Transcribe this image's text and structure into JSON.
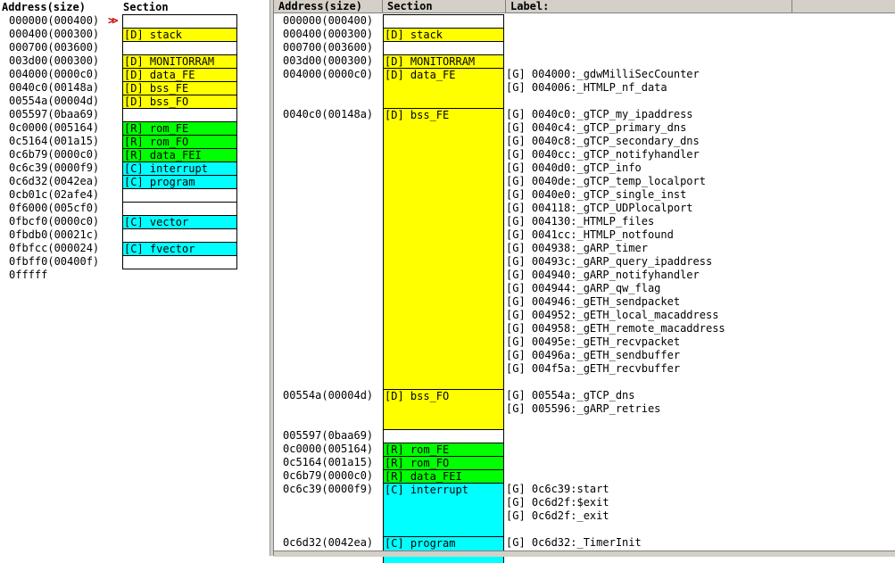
{
  "colors": {
    "data": "#ffff00",
    "rom": "#00ff00",
    "code": "#00ffff",
    "empty": "#ffffff",
    "arrow": "#c00000",
    "header": "#d4d0c8"
  },
  "left_panel": {
    "headers": {
      "address": "Address(size)",
      "section": "Section"
    },
    "rows": [
      {
        "address": "000000(000400)",
        "section": "",
        "kind": "empty",
        "marker": ">>"
      },
      {
        "address": "000400(000300)",
        "section": "[D] stack",
        "kind": "data"
      },
      {
        "address": "000700(003600)",
        "section": "",
        "kind": "empty"
      },
      {
        "address": "003d00(000300)",
        "section": "[D] MONITORRAM",
        "kind": "data"
      },
      {
        "address": "004000(0000c0)",
        "section": "[D] data_FE",
        "kind": "data"
      },
      {
        "address": "0040c0(00148a)",
        "section": "[D] bss_FE",
        "kind": "data"
      },
      {
        "address": "00554a(00004d)",
        "section": "[D] bss_FO",
        "kind": "data"
      },
      {
        "address": "005597(0baa69)",
        "section": "",
        "kind": "empty"
      },
      {
        "address": "0c0000(005164)",
        "section": "[R] rom_FE",
        "kind": "rom"
      },
      {
        "address": "0c5164(001a15)",
        "section": "[R] rom_FO",
        "kind": "rom"
      },
      {
        "address": "0c6b79(0000c0)",
        "section": "[R] data_FEI",
        "kind": "rom"
      },
      {
        "address": "0c6c39(0000f9)",
        "section": "[C] interrupt",
        "kind": "code"
      },
      {
        "address": "0c6d32(0042ea)",
        "section": "[C] program",
        "kind": "code"
      },
      {
        "address": "0cb01c(02afe4)",
        "section": "",
        "kind": "empty"
      },
      {
        "address": "0f6000(005cf0)",
        "section": "",
        "kind": "empty"
      },
      {
        "address": "0fbcf0(0000c0)",
        "section": "[C] vector",
        "kind": "code"
      },
      {
        "address": "0fbdb0(00021c)",
        "section": "",
        "kind": "empty"
      },
      {
        "address": "0fbfcc(000024)",
        "section": "[C] fvector",
        "kind": "code"
      },
      {
        "address": "0fbff0(00400f)",
        "section": "",
        "kind": "empty"
      }
    ],
    "end_address": "0fffff"
  },
  "right_panel": {
    "headers": {
      "address": "Address(size)",
      "section": "Section",
      "label": "Label:"
    },
    "blocks": [
      {
        "address": "000000(000400)",
        "section": "",
        "kind": "empty",
        "lines": 1,
        "labels": []
      },
      {
        "address": "000400(000300)",
        "section": "[D] stack",
        "kind": "data",
        "lines": 1,
        "labels": []
      },
      {
        "address": "000700(003600)",
        "section": "",
        "kind": "empty",
        "lines": 1,
        "labels": []
      },
      {
        "address": "003d00(000300)",
        "section": "[D] MONITORRAM",
        "kind": "data",
        "lines": 1,
        "labels": []
      },
      {
        "address": "004000(0000c0)",
        "section": "[D] data_FE",
        "kind": "data",
        "lines": 3,
        "labels": [
          "[G] 004000:_gdwMilliSecCounter",
          "[G] 004006:_HTMLP_nf_data"
        ]
      },
      {
        "address": "0040c0(00148a)",
        "section": "[D] bss_FE",
        "kind": "data",
        "lines": 21,
        "labels": [
          "[G] 0040c0:_gTCP_my_ipaddress",
          "[G] 0040c4:_gTCP_primary_dns",
          "[G] 0040c8:_gTCP_secondary_dns",
          "[G] 0040cc:_gTCP_notifyhandler",
          "[G] 0040d0:_gTCP_info",
          "[G] 0040de:_gTCP_temp_localport",
          "[G] 0040e0:_gTCP_single_inst",
          "[G] 004118:_gTCP_UDPlocalport",
          "[G] 004130:_HTMLP_files",
          "[G] 0041cc:_HTMLP_notfound",
          "[G] 004938:_gARP_timer",
          "[G] 00493c:_gARP_query_ipaddress",
          "[G] 004940:_gARP_notifyhandler",
          "[G] 004944:_gARP_qw_flag",
          "[G] 004946:_gETH_sendpacket",
          "[G] 004952:_gETH_local_macaddress",
          "[G] 004958:_gETH_remote_macaddress",
          "[G] 00495e:_gETH_recvpacket",
          "[G] 00496a:_gETH_sendbuffer",
          "[G] 004f5a:_gETH_recvbuffer"
        ]
      },
      {
        "address": "00554a(00004d)",
        "section": "[D] bss_FO",
        "kind": "data",
        "lines": 3,
        "labels": [
          "[G] 00554a:_gTCP_dns",
          "[G] 005596:_gARP_retries"
        ]
      },
      {
        "address": "005597(0baa69)",
        "section": "",
        "kind": "empty",
        "lines": 1,
        "labels": []
      },
      {
        "address": "0c0000(005164)",
        "section": "[R] rom_FE",
        "kind": "rom",
        "lines": 1,
        "labels": []
      },
      {
        "address": "0c5164(001a15)",
        "section": "[R] rom_FO",
        "kind": "rom",
        "lines": 1,
        "labels": []
      },
      {
        "address": "0c6b79(0000c0)",
        "section": "[R] data_FEI",
        "kind": "rom",
        "lines": 1,
        "labels": []
      },
      {
        "address": "0c6c39(0000f9)",
        "section": "[C] interrupt",
        "kind": "code",
        "lines": 4,
        "labels": [
          "[G] 0c6c39:start",
          "[G] 0c6d2f:$exit",
          "[G] 0c6d2f:_exit"
        ]
      },
      {
        "address": "0c6d32(0042ea)",
        "section": "[C] program",
        "kind": "code",
        "lines": 2,
        "labels": [
          "[G] 0c6d32:_TimerInit"
        ]
      }
    ]
  }
}
